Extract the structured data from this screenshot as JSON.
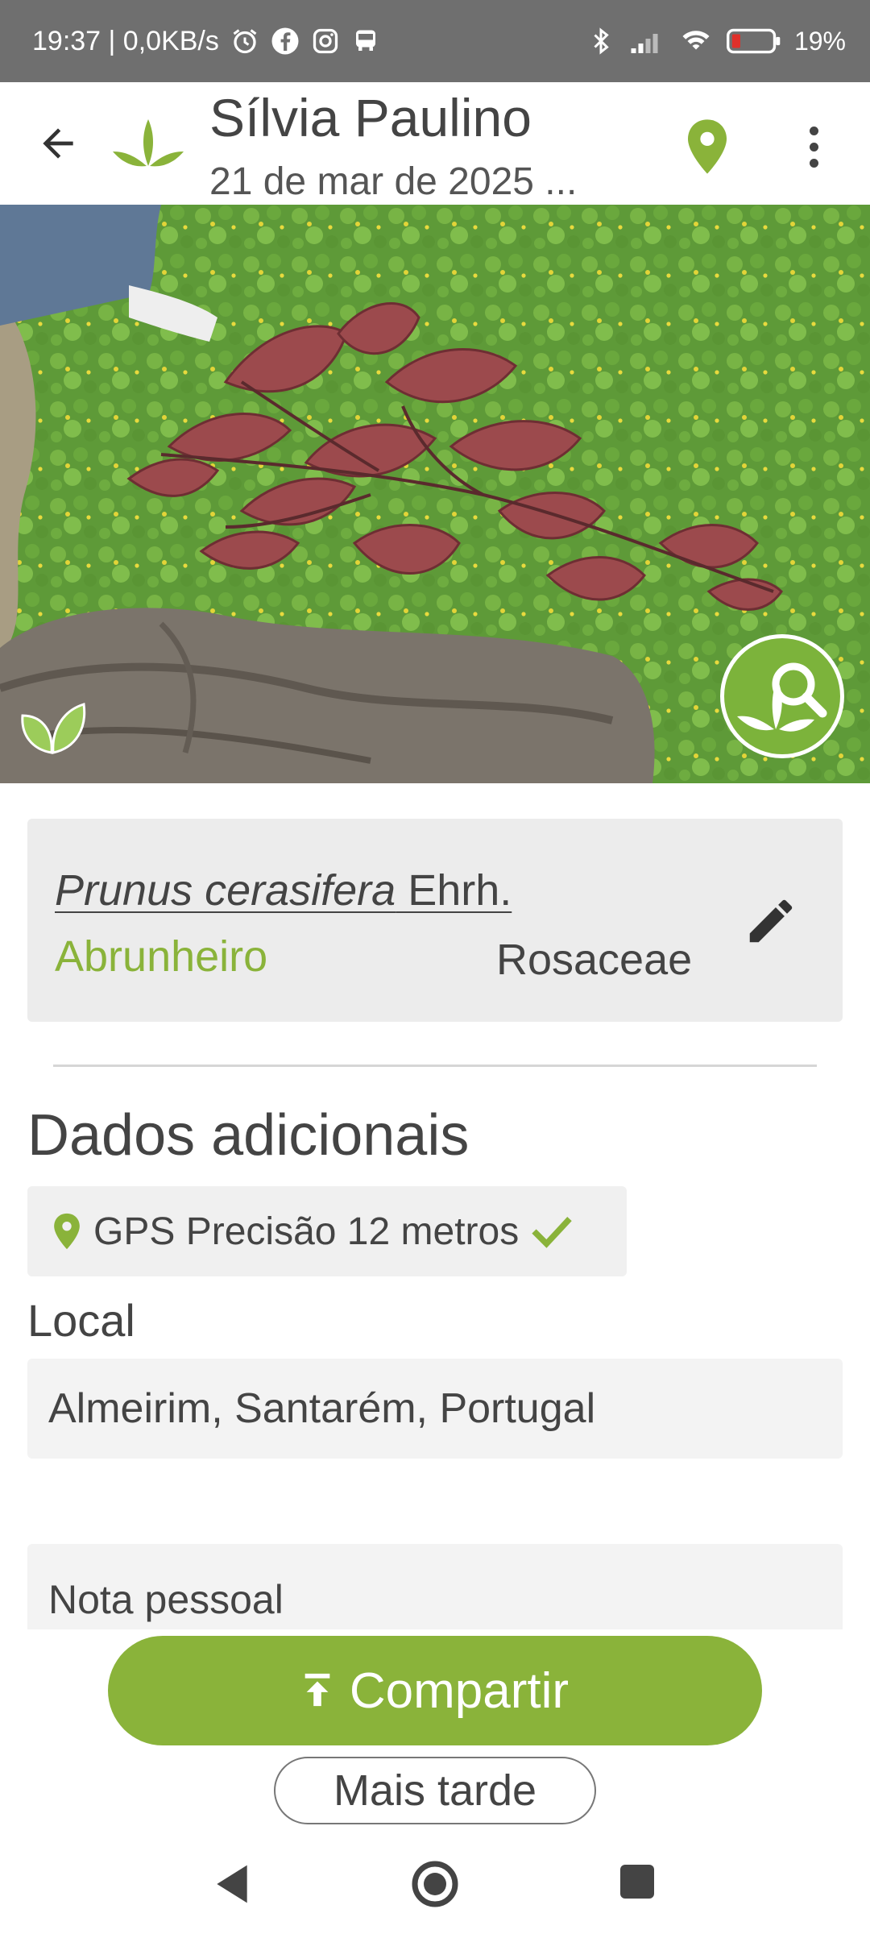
{
  "status_bar": {
    "time_speed": "19:37 | 0,0KB/s",
    "battery": "19%",
    "icons": [
      "alarm-icon",
      "facebook-icon",
      "instagram-icon",
      "bus-icon",
      "bluetooth-icon",
      "signal-icon",
      "wifi-icon",
      "battery-icon"
    ]
  },
  "header": {
    "title": "Sílvia Paulino",
    "subtitle": "21 de mar de 2025 ...",
    "icons": [
      "back-arrow-icon",
      "app-leaf-logo",
      "map-pin-icon",
      "more-vert-icon"
    ]
  },
  "photo": {
    "badge_icon": "leaf-icon",
    "identify_icon": "leaf-search-icon"
  },
  "species": {
    "scientific_name": "Prunus cerasifera",
    "author": " Ehrh.",
    "common_name": "Abrunheiro",
    "family": "Rosaceae",
    "edit_icon": "pencil-icon"
  },
  "additional": {
    "section_title": "Dados adicionais",
    "gps_text": "GPS Precisão 12 metros",
    "local_label": "Local",
    "local_value": "Almeirim, Santarém, Portugal",
    "note_placeholder": "Nota pessoal"
  },
  "actions": {
    "share_label": "Compartir",
    "later_label": "Mais tarde"
  },
  "colors": {
    "accent_green": "#8ab33a",
    "status_bar": "#6f6f6f",
    "card_bg": "#ececec"
  }
}
